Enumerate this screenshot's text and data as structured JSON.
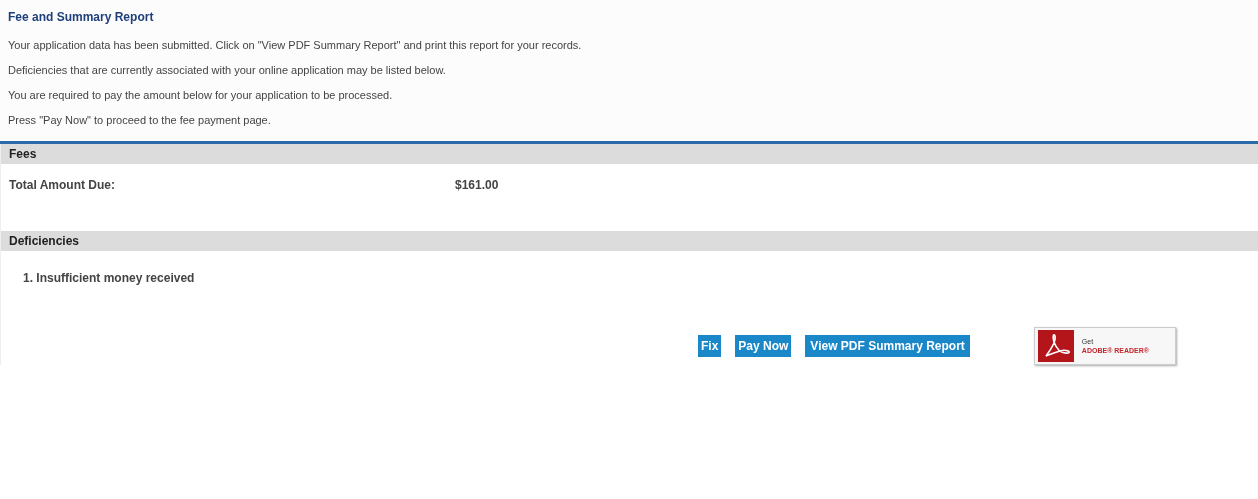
{
  "title": "Fee and Summary Report",
  "intro": [
    "Your application data has been submitted. Click on \"View PDF Summary Report\" and print this report for your records.",
    "Deficiencies that are currently associated with your online application may be listed below.",
    "You are required to pay the amount below for your application to be processed.",
    "Press \"Pay Now\" to proceed to the fee payment page."
  ],
  "fees": {
    "heading": "Fees",
    "label": "Total Amount Due:",
    "amount": "$161.00"
  },
  "deficiencies": {
    "heading": "Deficiencies",
    "items": [
      "1. Insufficient money received"
    ]
  },
  "buttons": [
    "Fix",
    "Pay Now",
    "View PDF Summary Report"
  ],
  "reader_badge": {
    "line_1": "Get",
    "line_2": "ADOBE® READER®"
  }
}
